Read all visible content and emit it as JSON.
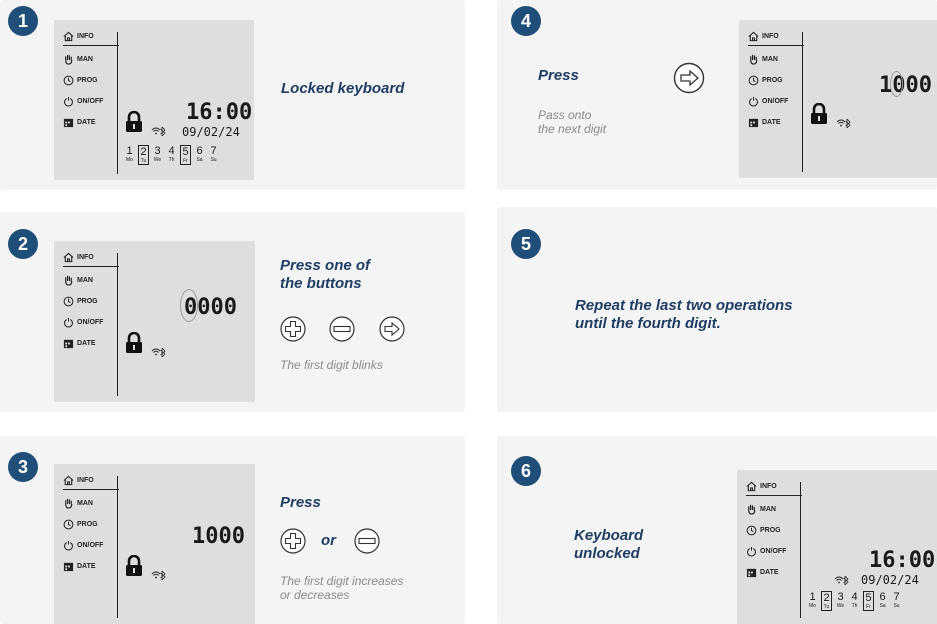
{
  "menu": {
    "info": "INFO",
    "man": "MAN",
    "prog": "PROG",
    "onoff": "ON/OFF",
    "date": "DATE"
  },
  "display": {
    "time": "16:00",
    "date": "09/02/24",
    "code_blank": "0000",
    "code_first": "1000",
    "code_next": "1000"
  },
  "days": [
    {
      "n": "1",
      "l": "Mo"
    },
    {
      "n": "2",
      "l": "Tu"
    },
    {
      "n": "3",
      "l": "We"
    },
    {
      "n": "4",
      "l": "Th"
    },
    {
      "n": "5",
      "l": "Fr"
    },
    {
      "n": "6",
      "l": "Sa"
    },
    {
      "n": "7",
      "l": "Su"
    }
  ],
  "steps": [
    {
      "num": "1",
      "title": "Locked keyboard"
    },
    {
      "num": "2",
      "title_line1": "Press one of",
      "title_line2": "the buttons",
      "note": "The first digit blinks"
    },
    {
      "num": "3",
      "title": "Press",
      "or": "or",
      "note_line1": "The first digit increases",
      "note_line2": "or decreases"
    },
    {
      "num": "4",
      "title": "Press",
      "note_line1": "Pass onto",
      "note_line2": "the next digit"
    },
    {
      "num": "5",
      "title_line1": "Repeat the last two operations",
      "title_line2": "until the fourth digit."
    },
    {
      "num": "6",
      "title_line1": "Keyboard",
      "title_line2": "unlocked"
    }
  ],
  "colors": {
    "accent": "#1f4e79",
    "title": "#1f3d63",
    "note": "#8a8a8a",
    "lcd": "#dedede",
    "card": "#f4f4f4"
  },
  "icons": [
    "home-icon",
    "hand-icon",
    "clock-icon",
    "power-icon",
    "calendar-icon",
    "lock-icon",
    "wifi-icon",
    "bluetooth-icon",
    "plus-button-icon",
    "minus-button-icon",
    "arrow-right-button-icon"
  ]
}
